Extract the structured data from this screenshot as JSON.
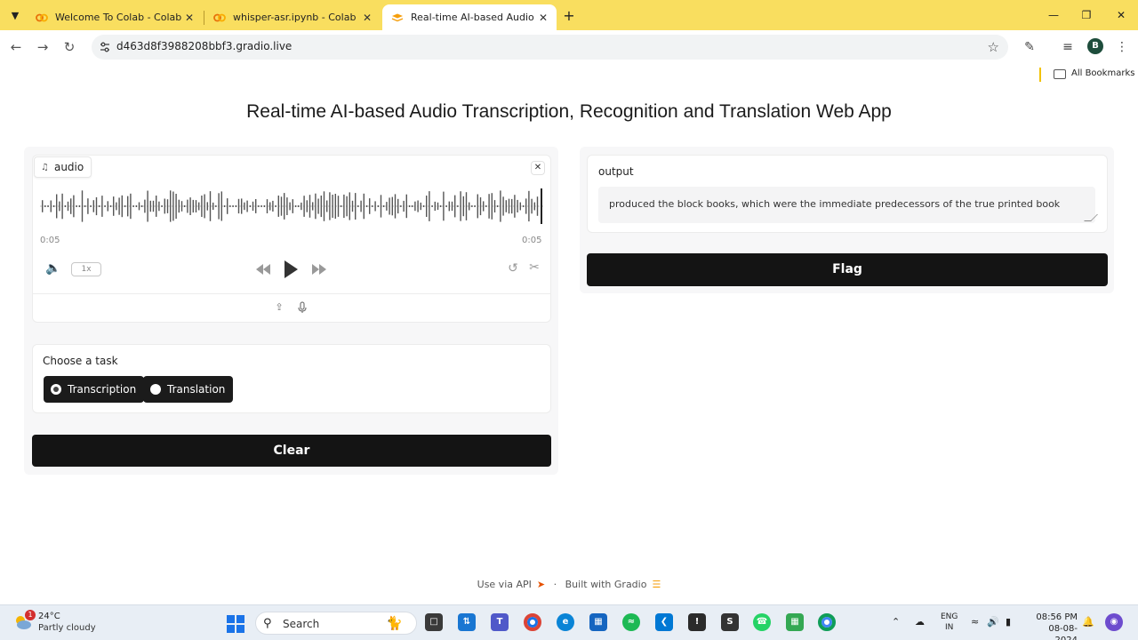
{
  "browser": {
    "tabs": [
      {
        "title": "Welcome To Colab - Colab",
        "active": false
      },
      {
        "title": "whisper-asr.ipynb - Colab",
        "active": false
      },
      {
        "title": "Real-time AI-based Audio Trans",
        "active": true
      }
    ],
    "url": "d463d8f3988208bbf3.gradio.live",
    "profile_initial": "B",
    "bookmarks_label": "All Bookmarks"
  },
  "page": {
    "title": "Real-time AI-based Audio Transcription, Recognition and Translation Web App"
  },
  "audio": {
    "label": "audio",
    "time_current": "0:05",
    "time_total": "0:05",
    "speed": "1x"
  },
  "task": {
    "label": "Choose a task",
    "options": [
      {
        "label": "Transcription",
        "checked": true
      },
      {
        "label": "Translation",
        "checked": false
      }
    ]
  },
  "buttons": {
    "clear": "Clear",
    "flag": "Flag"
  },
  "output": {
    "label": "output",
    "value": "produced the block books, which were the immediate predecessors of the true printed book"
  },
  "footer": {
    "api": "Use via API",
    "separator": "·",
    "built": "Built with Gradio"
  },
  "taskbar": {
    "weather_temp": "24°C",
    "weather_desc": "Partly cloudy",
    "weather_badge": "1",
    "search": "Search",
    "lang_line1": "ENG",
    "lang_line2": "IN",
    "time": "08:56 PM",
    "date": "08-08-2024"
  },
  "colors": {
    "tabbar": "#f9de5f",
    "button_dark": "#141414",
    "panel_bg": "#f7f7f8"
  }
}
